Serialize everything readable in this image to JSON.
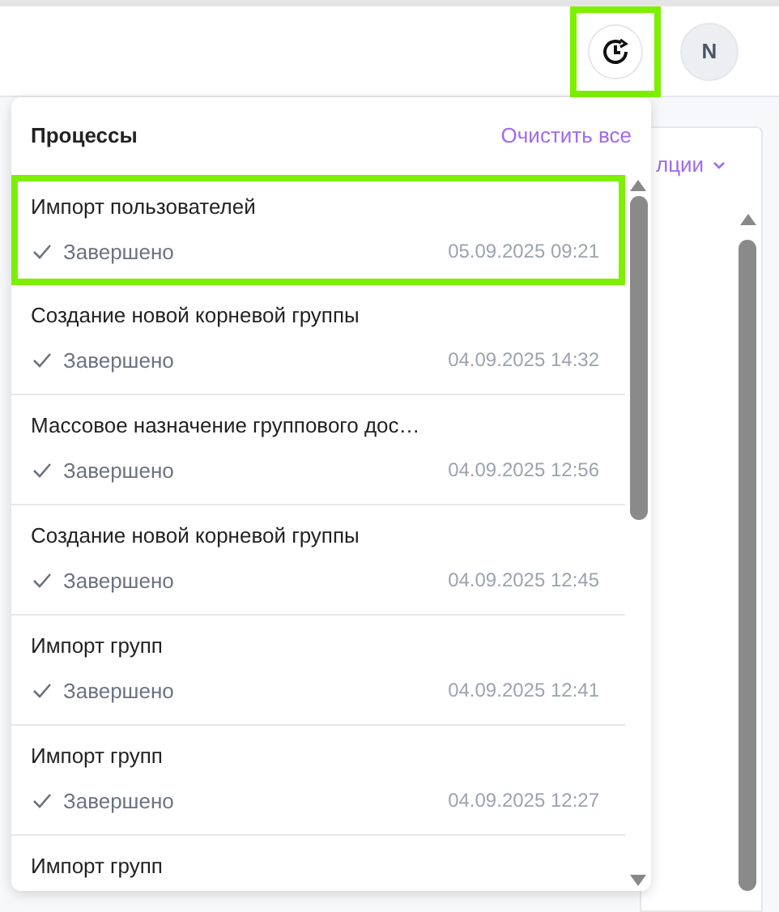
{
  "header": {
    "history_button": {
      "highlighted": true
    },
    "avatar": {
      "initial": "N"
    }
  },
  "background": {
    "partial_link": "лции"
  },
  "processes_panel": {
    "title": "Процессы",
    "clear_all": "Очистить все",
    "items": [
      {
        "name": "Импорт пользователей",
        "status": "Завершено",
        "time": "05.09.2025 09:21",
        "highlighted": true
      },
      {
        "name": "Создание новой корневой группы",
        "status": "Завершено",
        "time": "04.09.2025 14:32",
        "highlighted": false
      },
      {
        "name": "Массовое назначение группового дос…",
        "status": "Завершено",
        "time": "04.09.2025 12:56",
        "highlighted": false
      },
      {
        "name": "Создание новой корневой группы",
        "status": "Завершено",
        "time": "04.09.2025 12:45",
        "highlighted": false
      },
      {
        "name": "Импорт групп",
        "status": "Завершено",
        "time": "04.09.2025 12:41",
        "highlighted": false
      },
      {
        "name": "Импорт групп",
        "status": "Завершено",
        "time": "04.09.2025 12:27",
        "highlighted": false
      },
      {
        "name": "Импорт групп"
      }
    ]
  }
}
